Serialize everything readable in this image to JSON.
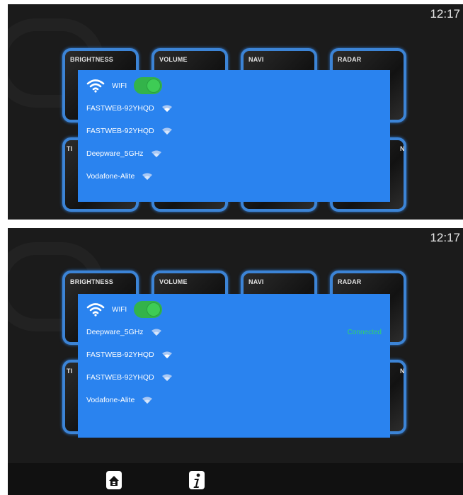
{
  "clock": "12:17",
  "tiles_top": [
    "BRIGHTNESS",
    "VOLUME",
    "NAVI",
    "RADAR"
  ],
  "tiles_bottom_left": "TI",
  "tiles_bottom_right": "N",
  "panel1": {
    "wifi_label": "WIFI",
    "networks": [
      {
        "name": "FASTWEB-92YHQD"
      },
      {
        "name": "FASTWEB-92YHQD"
      },
      {
        "name": "Deepware_5GHz"
      },
      {
        "name": "Vodafone-Alite"
      }
    ]
  },
  "panel2": {
    "wifi_label": "WIFI",
    "networks": [
      {
        "name": "Deepware_5GHz",
        "status": "Connected"
      },
      {
        "name": "FASTWEB-92YHQD"
      },
      {
        "name": "FASTWEB-92YHQD"
      },
      {
        "name": "Vodafone-Alite"
      }
    ]
  },
  "colors": {
    "accent": "#2a83ef",
    "toggle": "#33b34a",
    "connected": "#2fd36f",
    "tile_border": "#3c84d6"
  },
  "bottom_bar": {
    "icons": [
      "home-icon",
      "info-icon"
    ]
  }
}
